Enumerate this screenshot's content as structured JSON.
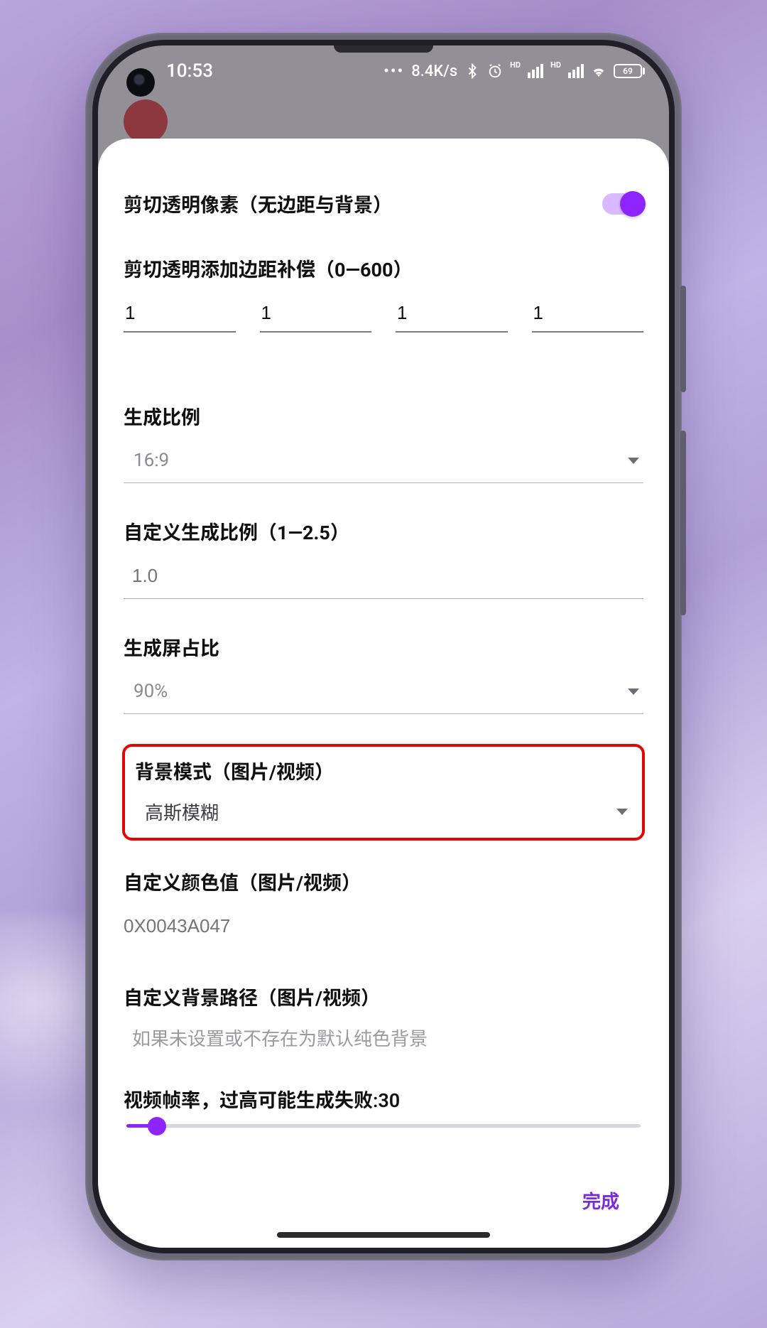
{
  "statusbar": {
    "time": "10:53",
    "net_speed": "8.4K/s",
    "battery": "69"
  },
  "toggle_row": {
    "label": "剪切透明像素（无边距与背景）"
  },
  "padding_section": {
    "label": "剪切透明添加边距补偿（0—600）",
    "values": [
      "1",
      "1",
      "1",
      "1"
    ]
  },
  "ratio_section": {
    "label": "生成比例",
    "value": "16:9"
  },
  "custom_ratio_section": {
    "label": "自定义生成比例（1—2.5）",
    "placeholder": "1.0"
  },
  "screen_pct_section": {
    "label": "生成屏占比",
    "value": "90%"
  },
  "bgmode_section": {
    "label": "背景模式（图片/视频）",
    "value": "高斯模糊"
  },
  "color_section": {
    "label": "自定义颜色值（图片/视频）",
    "placeholder": "0X0043A047"
  },
  "bgpath_section": {
    "label": "自定义背景路径（图片/视频）",
    "hint": "如果未设置或不存在为默认纯色背景"
  },
  "fps_section": {
    "label": "视频帧率，过高可能生成失败:30"
  },
  "footer": {
    "done": "完成"
  }
}
